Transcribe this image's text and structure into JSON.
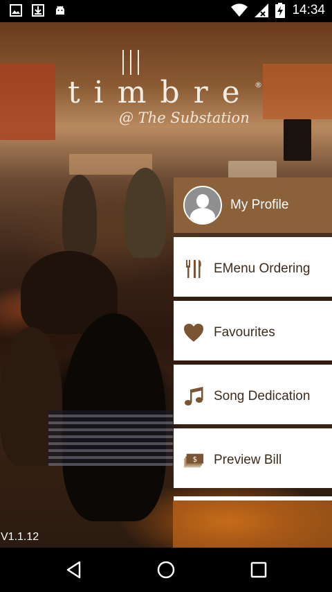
{
  "status_bar": {
    "time": "14:34",
    "left_icons": [
      "image-icon",
      "download-icon",
      "android-icon"
    ],
    "right_icons": [
      "wifi-icon",
      "signal-icon",
      "battery-charging-icon"
    ]
  },
  "logo": {
    "word": "timbre",
    "registered": "®",
    "subtitle": "@ The Substation"
  },
  "menu": {
    "profile_label": "My Profile",
    "items": [
      {
        "label": "EMenu Ordering",
        "icon": "fork-knife-icon"
      },
      {
        "label": "Favourites",
        "icon": "heart-icon"
      },
      {
        "label": "Song Dedication",
        "icon": "music-note-icon"
      },
      {
        "label": "Preview Bill",
        "icon": "money-icon"
      }
    ]
  },
  "version": "V1.1.12",
  "colors": {
    "brand_brown": "#8b6139",
    "icon_brown": "#7a5533",
    "text_dark": "#3d2b1c"
  }
}
